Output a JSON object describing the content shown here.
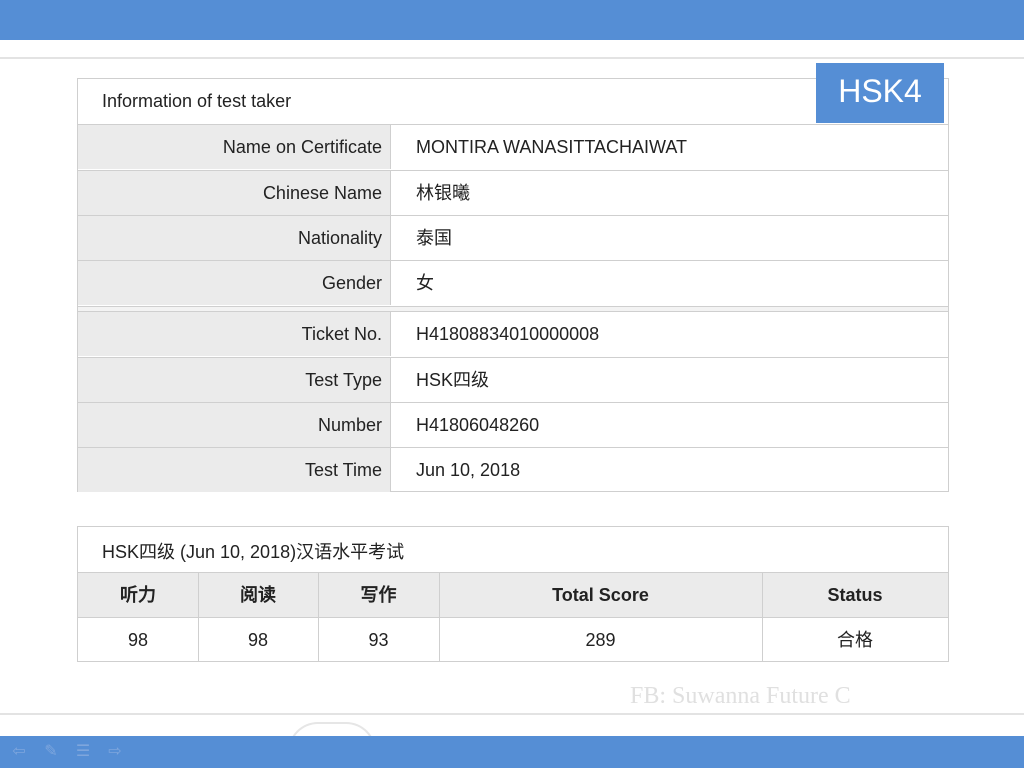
{
  "badge": "HSK4",
  "info": {
    "title": "Information of test taker",
    "rows": [
      {
        "label": "Name on Certificate",
        "value": "MONTIRA WANASITTACHAIWAT"
      },
      {
        "label": "Chinese Name",
        "value": "林银曦"
      },
      {
        "label": "Nationality",
        "value": "泰国"
      },
      {
        "label": "Gender",
        "value": "女"
      },
      {
        "label": "Ticket No.",
        "value": "H41808834010000008"
      },
      {
        "label": "Test Type",
        "value": "HSK四级"
      },
      {
        "label": "Number",
        "value": "H41806048260"
      },
      {
        "label": "Test Time",
        "value": "Jun 10, 2018"
      }
    ]
  },
  "scores": {
    "title": "HSK四级 (Jun 10, 2018)汉语水平考试",
    "headers": [
      "听力",
      "阅读",
      "写作",
      "Total Score",
      "Status"
    ],
    "values": [
      "98",
      "98",
      "93",
      "289",
      "合格"
    ]
  },
  "watermark": "FB: Suwanna Future C",
  "colors": {
    "accent": "#558ed5",
    "label_bg": "#ebebeb",
    "border": "#cfcfcf"
  },
  "nav_icons": [
    "back-arrow-icon",
    "pen-icon",
    "menu-icon",
    "forward-arrow-icon"
  ]
}
